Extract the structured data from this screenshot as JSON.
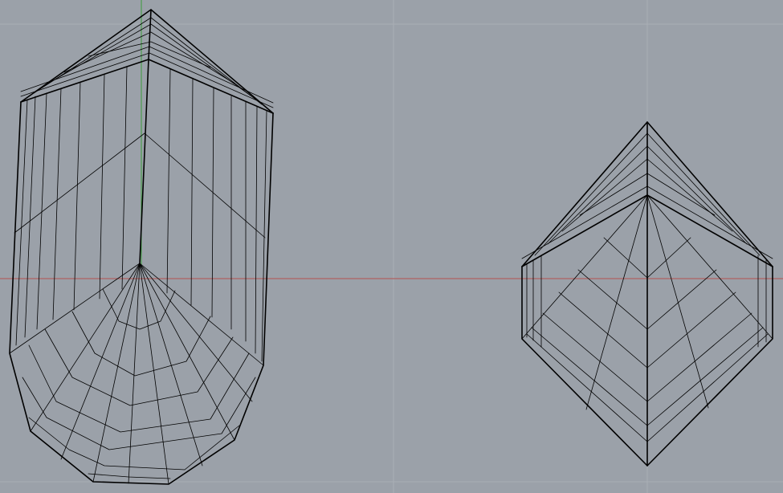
{
  "viewport": {
    "background_color": "#9ba1a9",
    "grid_color": "#a9aeb5",
    "x_axis_color": "#b4514e",
    "y_axis_color": "#3b9a3b",
    "wireframe_color": "#000000"
  },
  "objects": [
    {
      "kind": "wireframe-mesh"
    },
    {
      "kind": "wireframe-mesh"
    }
  ]
}
